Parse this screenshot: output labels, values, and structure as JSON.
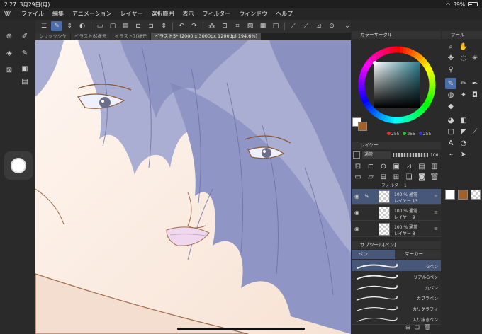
{
  "status": {
    "time": "2:27",
    "date": "3月29日(月)",
    "battery": "39%"
  },
  "menu": [
    "ファイル",
    "編集",
    "アニメーション",
    "レイヤー",
    "選択範囲",
    "表示",
    "フィルター",
    "ウィンドウ",
    "ヘルプ"
  ],
  "tabs": [
    {
      "label": "シリックシヤ"
    },
    {
      "label": "イラスト8(複元"
    },
    {
      "label": "イラスト7(複元"
    },
    {
      "label": "イラスト5* (2000 x 3000px 1200dpi 194.6%)"
    }
  ],
  "color_panel": {
    "title": "カラーサークル",
    "rgb": {
      "r": "255",
      "g": "255",
      "b": "255"
    },
    "colors": {
      "main": "#ffffff",
      "sub": "#a0622a",
      "hue_square": "#2f7f8f"
    }
  },
  "layer_panel": {
    "title": "レイヤー",
    "blend_mode": "通常",
    "opacity": "100",
    "folder": "フォルダー 1",
    "layers": [
      {
        "line1": "100 % 通常",
        "line2": "レイヤー 13",
        "selected": true
      },
      {
        "line1": "100 % 通常",
        "line2": "レイヤー 9",
        "selected": false
      },
      {
        "line1": "100 % 通常",
        "line2": "レイヤー 8",
        "selected": false
      }
    ]
  },
  "subtool_panel": {
    "title": "サブツール[ペン]",
    "tabs": [
      "ペン",
      "マーカー"
    ],
    "brushes": [
      "Gペン",
      "リアルGペン",
      "丸ペン",
      "カブラペン",
      "カリグラフィ",
      "入り抜きペン"
    ]
  },
  "tool_panel": {
    "title": "ツール"
  },
  "canvas": {
    "skin": "#fdf2ea",
    "hair": "#a9aed2",
    "hair_dark": "#7d84b8",
    "line": "#8a5a3a",
    "lip": "#efd8ee"
  }
}
